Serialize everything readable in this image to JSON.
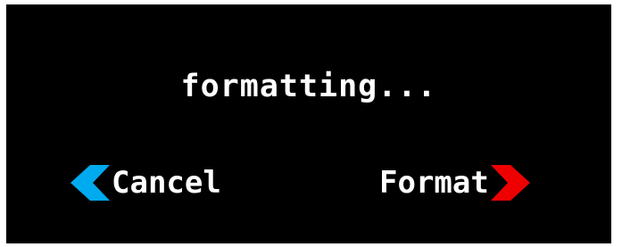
{
  "status": {
    "text": "formatting..."
  },
  "softkeys": {
    "left": {
      "label": "Cancel",
      "icon": "left-chevron-icon",
      "color": "#00aaee"
    },
    "right": {
      "label": "Format",
      "icon": "right-chevron-icon",
      "color": "#ee0000"
    }
  }
}
